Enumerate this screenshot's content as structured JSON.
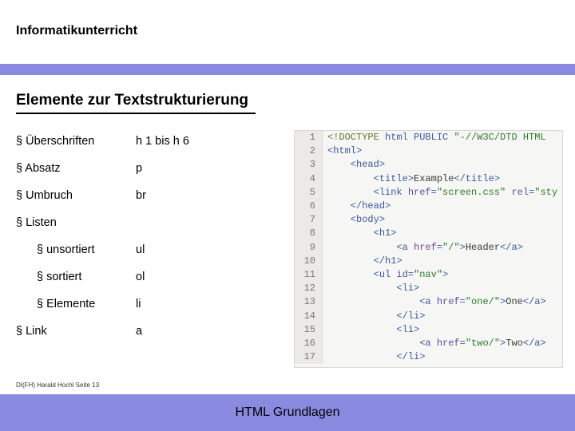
{
  "header": {
    "title": "Informatikunterricht"
  },
  "section": {
    "title": "Elemente zur Textstrukturierung"
  },
  "items": [
    {
      "label": "Überschriften",
      "value": "h 1 bis h 6",
      "indent": 0
    },
    {
      "label": "Absatz",
      "value": "p",
      "indent": 0
    },
    {
      "label": "Umbruch",
      "value": "br",
      "indent": 0
    },
    {
      "label": "Listen",
      "value": "",
      "indent": 0
    },
    {
      "label": "unsortiert",
      "value": "ul",
      "indent": 1
    },
    {
      "label": "sortiert",
      "value": "ol",
      "indent": 1
    },
    {
      "label": "Elemente",
      "value": "li",
      "indent": 1
    },
    {
      "label": "Link",
      "value": "a",
      "indent": 0
    }
  ],
  "code": {
    "lines": [
      {
        "n": 1,
        "tokens": [
          {
            "t": "<!",
            "c": "doctype"
          },
          {
            "t": "DOCTYPE ",
            "c": "doctype"
          },
          {
            "t": "html PUBLIC ",
            "c": "tag"
          },
          {
            "t": "\"-//W3C/DTD HTML",
            "c": "str"
          }
        ]
      },
      {
        "n": 2,
        "tokens": [
          {
            "t": "<",
            "c": "tag"
          },
          {
            "t": "html",
            "c": "tag"
          },
          {
            "t": ">",
            "c": "tag"
          }
        ]
      },
      {
        "n": 3,
        "tokens": [
          {
            "t": "    <",
            "c": "tag"
          },
          {
            "t": "head",
            "c": "tag"
          },
          {
            "t": ">",
            "c": "tag"
          }
        ]
      },
      {
        "n": 4,
        "tokens": [
          {
            "t": "        <",
            "c": "tag"
          },
          {
            "t": "title",
            "c": "tag"
          },
          {
            "t": ">",
            "c": "tag"
          },
          {
            "t": "Example",
            "c": "text"
          },
          {
            "t": "</",
            "c": "tag"
          },
          {
            "t": "title",
            "c": "tag"
          },
          {
            "t": ">",
            "c": "tag"
          }
        ]
      },
      {
        "n": 5,
        "tokens": [
          {
            "t": "        <",
            "c": "tag"
          },
          {
            "t": "link ",
            "c": "tag"
          },
          {
            "t": "href",
            "c": "attr"
          },
          {
            "t": "=",
            "c": "tag"
          },
          {
            "t": "\"screen.css\"",
            "c": "str"
          },
          {
            "t": " rel",
            "c": "attr"
          },
          {
            "t": "=",
            "c": "tag"
          },
          {
            "t": "\"sty",
            "c": "str"
          }
        ]
      },
      {
        "n": 6,
        "tokens": [
          {
            "t": "    </",
            "c": "tag"
          },
          {
            "t": "head",
            "c": "tag"
          },
          {
            "t": ">",
            "c": "tag"
          }
        ]
      },
      {
        "n": 7,
        "tokens": [
          {
            "t": "    <",
            "c": "tag"
          },
          {
            "t": "body",
            "c": "tag"
          },
          {
            "t": ">",
            "c": "tag"
          }
        ]
      },
      {
        "n": 8,
        "tokens": [
          {
            "t": "        <",
            "c": "tag"
          },
          {
            "t": "h1",
            "c": "tag"
          },
          {
            "t": ">",
            "c": "tag"
          }
        ]
      },
      {
        "n": 9,
        "tokens": [
          {
            "t": "            <",
            "c": "tag"
          },
          {
            "t": "a ",
            "c": "tag"
          },
          {
            "t": "href",
            "c": "attr"
          },
          {
            "t": "=",
            "c": "tag"
          },
          {
            "t": "\"/\"",
            "c": "str"
          },
          {
            "t": ">",
            "c": "tag"
          },
          {
            "t": "Header",
            "c": "text"
          },
          {
            "t": "</",
            "c": "tag"
          },
          {
            "t": "a",
            "c": "tag"
          },
          {
            "t": ">",
            "c": "tag"
          }
        ]
      },
      {
        "n": 10,
        "tokens": [
          {
            "t": "        </",
            "c": "tag"
          },
          {
            "t": "h1",
            "c": "tag"
          },
          {
            "t": ">",
            "c": "tag"
          }
        ]
      },
      {
        "n": 11,
        "tokens": [
          {
            "t": "        <",
            "c": "tag"
          },
          {
            "t": "ul ",
            "c": "tag"
          },
          {
            "t": "id",
            "c": "attr"
          },
          {
            "t": "=",
            "c": "tag"
          },
          {
            "t": "\"nav\"",
            "c": "str"
          },
          {
            "t": ">",
            "c": "tag"
          }
        ]
      },
      {
        "n": 12,
        "tokens": [
          {
            "t": "            <",
            "c": "tag"
          },
          {
            "t": "li",
            "c": "tag"
          },
          {
            "t": ">",
            "c": "tag"
          }
        ]
      },
      {
        "n": 13,
        "tokens": [
          {
            "t": "                <",
            "c": "tag"
          },
          {
            "t": "a ",
            "c": "tag"
          },
          {
            "t": "href",
            "c": "attr"
          },
          {
            "t": "=",
            "c": "tag"
          },
          {
            "t": "\"one/\"",
            "c": "str"
          },
          {
            "t": ">",
            "c": "tag"
          },
          {
            "t": "One",
            "c": "text"
          },
          {
            "t": "</",
            "c": "tag"
          },
          {
            "t": "a",
            "c": "tag"
          },
          {
            "t": ">",
            "c": "tag"
          }
        ]
      },
      {
        "n": 14,
        "tokens": [
          {
            "t": "            </",
            "c": "tag"
          },
          {
            "t": "li",
            "c": "tag"
          },
          {
            "t": ">",
            "c": "tag"
          }
        ]
      },
      {
        "n": 15,
        "tokens": [
          {
            "t": "            <",
            "c": "tag"
          },
          {
            "t": "li",
            "c": "tag"
          },
          {
            "t": ">",
            "c": "tag"
          }
        ]
      },
      {
        "n": 16,
        "tokens": [
          {
            "t": "                <",
            "c": "tag"
          },
          {
            "t": "a ",
            "c": "tag"
          },
          {
            "t": "href",
            "c": "attr"
          },
          {
            "t": "=",
            "c": "tag"
          },
          {
            "t": "\"two/\"",
            "c": "str"
          },
          {
            "t": ">",
            "c": "tag"
          },
          {
            "t": "Two",
            "c": "text"
          },
          {
            "t": "</",
            "c": "tag"
          },
          {
            "t": "a",
            "c": "tag"
          },
          {
            "t": ">",
            "c": "tag"
          }
        ]
      },
      {
        "n": 17,
        "tokens": [
          {
            "t": "            </",
            "c": "tag"
          },
          {
            "t": "li",
            "c": "tag"
          },
          {
            "t": ">",
            "c": "tag"
          }
        ]
      }
    ]
  },
  "footer": {
    "left": "DI(FH) Harald Hochl Seite 13",
    "bar": "HTML Grundlagen"
  }
}
